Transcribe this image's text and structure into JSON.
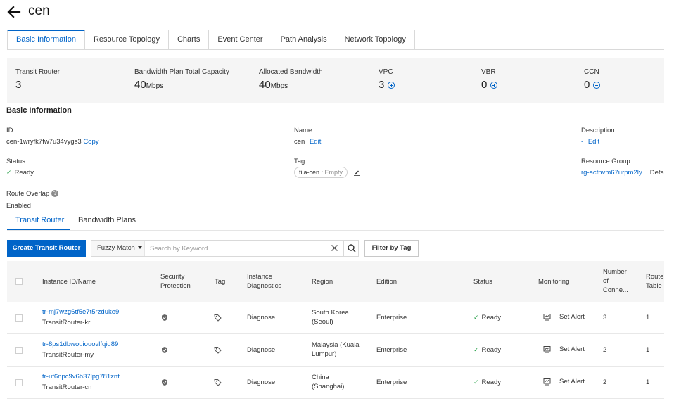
{
  "header": {
    "title": "cen"
  },
  "tabs": [
    {
      "label": "Basic Information",
      "active": true
    },
    {
      "label": "Resource Topology"
    },
    {
      "label": "Charts"
    },
    {
      "label": "Event Center"
    },
    {
      "label": "Path Analysis"
    },
    {
      "label": "Network Topology"
    }
  ],
  "stats": {
    "transit_router": {
      "label": "Transit Router",
      "value": "3"
    },
    "bandwidth_total": {
      "label": "Bandwidth Plan Total Capacity",
      "value": "40",
      "unit": "Mbps"
    },
    "allocated": {
      "label": "Allocated Bandwidth",
      "value": "40",
      "unit": "Mbps"
    },
    "vpc": {
      "label": "VPC",
      "value": "3"
    },
    "vbr": {
      "label": "VBR",
      "value": "0"
    },
    "ccn": {
      "label": "CCN",
      "value": "0"
    }
  },
  "basic_info": {
    "section_title": "Basic Information",
    "id_label": "ID",
    "id_value": "cen-1wryfk7fw7u34vygs3",
    "copy": "Copy",
    "name_label": "Name",
    "name_value": "cen",
    "edit": "Edit",
    "description_label": "Description",
    "description_value": "-",
    "status_label": "Status",
    "status_value": "Ready",
    "tag_label": "Tag",
    "tag_key": "fila-cen : ",
    "tag_val": "Empty",
    "resource_group_label": "Resource Group",
    "resource_group_value": "rg-acfnvm67urpm2ly",
    "resource_group_sep": "|",
    "resource_group_extra": "Defa",
    "route_overlap_label": "Route Overlap",
    "route_overlap_help": "?",
    "route_overlap_value": "Enabled"
  },
  "subtabs": {
    "transit_router": "Transit Router",
    "bandwidth_plans": "Bandwidth Plans"
  },
  "toolbar": {
    "create": "Create Transit Router",
    "fuzzy": "Fuzzy Match",
    "search_placeholder": "Search by Keyword.",
    "filter": "Filter by Tag"
  },
  "table": {
    "headers": {
      "instance": "Instance ID/Name",
      "security_1": "Security",
      "security_2": "Protection",
      "tag": "Tag",
      "diag_1": "Instance",
      "diag_2": "Diagnostics",
      "region": "Region",
      "edition": "Edition",
      "status": "Status",
      "monitoring": "Monitoring",
      "conn_1": "Number",
      "conn_2": "of",
      "conn_3": "Conne...",
      "route_1": "Route",
      "route_2": "Table"
    },
    "rows": [
      {
        "id": "tr-mj7wzg6tf5e7t5rzduke9",
        "name": "TransitRouter-kr",
        "diagnose": "Diagnose",
        "region_1": "South Korea",
        "region_2": "(Seoul)",
        "edition": "Enterprise",
        "status": "Ready",
        "alert": "Set Alert",
        "connections": "3",
        "route_tables": "1"
      },
      {
        "id": "tr-8ps1dbwouiouovlfqid89",
        "name": "TransitRouter-my",
        "diagnose": "Diagnose",
        "region_1": "Malaysia (Kuala",
        "region_2": "Lumpur)",
        "edition": "Enterprise",
        "status": "Ready",
        "alert": "Set Alert",
        "connections": "2",
        "route_tables": "1"
      },
      {
        "id": "tr-uf6npc9v6b37lpg781znt",
        "name": "TransitRouter-cn",
        "diagnose": "Diagnose",
        "region_1": "China",
        "region_2": "(Shanghai)",
        "edition": "Enterprise",
        "status": "Ready",
        "alert": "Set Alert",
        "connections": "2",
        "route_tables": "1"
      }
    ]
  },
  "colors": {
    "accent": "#0064c8",
    "success": "#2fa44f"
  }
}
